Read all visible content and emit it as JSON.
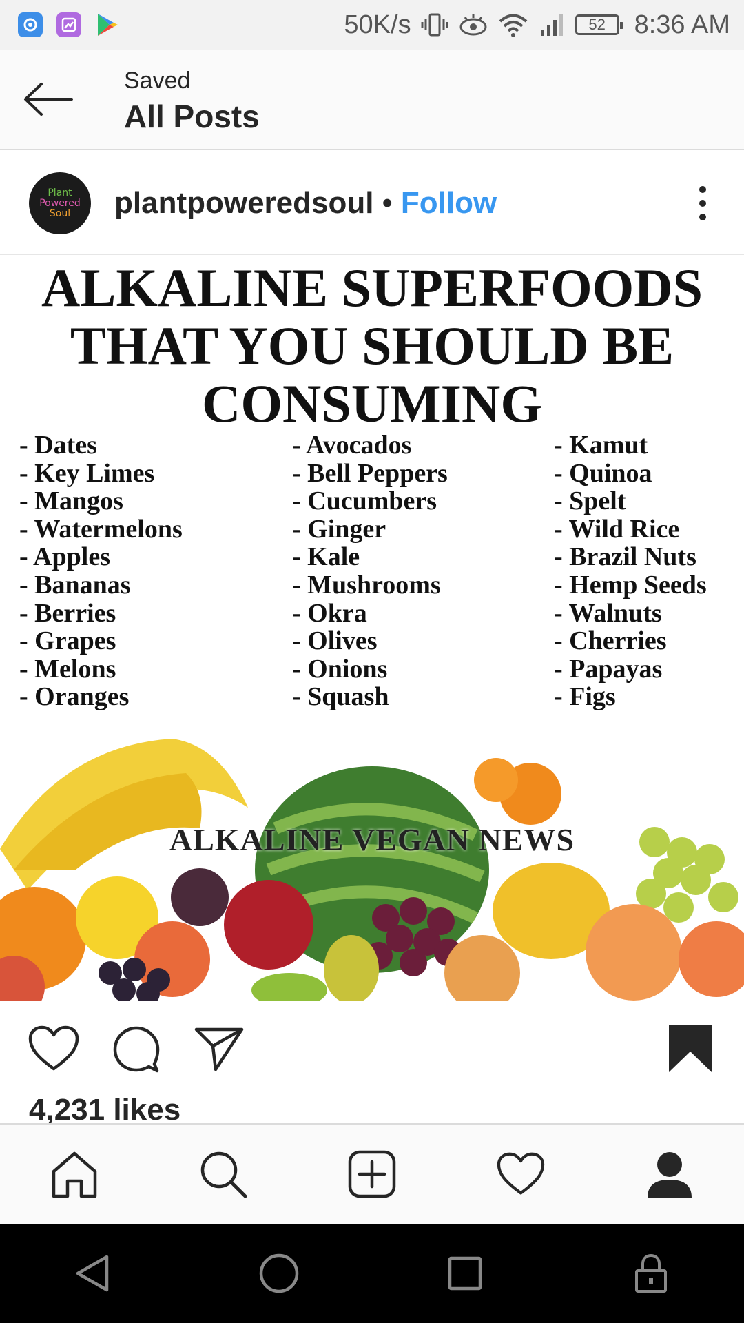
{
  "status_bar": {
    "net_speed": "50K/s",
    "battery": "52",
    "time": "8:36 AM",
    "icons": [
      "photos-app-icon",
      "gallery-app-icon",
      "play-store-icon",
      "vibrate-icon",
      "eye-comfort-icon",
      "wifi-icon",
      "signal-icon",
      "battery-icon"
    ]
  },
  "header": {
    "subtitle": "Saved",
    "title": "All Posts",
    "back_icon": "arrow-left-icon"
  },
  "post": {
    "username": "plantpoweredsoul",
    "separator": "•",
    "follow_label": "Follow",
    "follow_color": "#3897f0",
    "avatar_text": [
      "Plant",
      "Powered",
      "Soul"
    ],
    "image": {
      "title_lines": [
        "ALKALINE SUPERFOODS",
        "THAT YOU SHOULD BE",
        "CONSUMING"
      ],
      "columns": [
        [
          "- Dates",
          "- Key Limes",
          "- Mangos",
          "- Watermelons",
          "- Apples",
          "- Bananas",
          "- Berries",
          "- Grapes",
          "- Melons",
          "- Oranges"
        ],
        [
          "- Avocados",
          "- Bell Peppers",
          "- Cucumbers",
          "- Ginger",
          "- Kale",
          "- Mushrooms",
          "- Okra",
          "- Olives",
          "- Onions",
          "- Squash"
        ],
        [
          "- Kamut",
          "- Quinoa",
          "- Spelt",
          "- Wild Rice",
          "- Brazil Nuts",
          "- Hemp Seeds",
          "- Walnuts",
          "- Cherries",
          "- Papayas",
          "- Figs"
        ]
      ],
      "watermark": "ALKALINE VEGAN NEWS"
    },
    "likes": "4,231 likes",
    "actions": [
      "heart-icon",
      "comment-icon",
      "share-icon",
      "bookmark-icon"
    ]
  },
  "bottom_nav": [
    "home-icon",
    "search-icon",
    "add-post-icon",
    "activity-heart-icon",
    "profile-icon"
  ],
  "system_nav": [
    "back-triangle-icon",
    "home-circle-icon",
    "recents-square-icon",
    "lock-icon"
  ]
}
